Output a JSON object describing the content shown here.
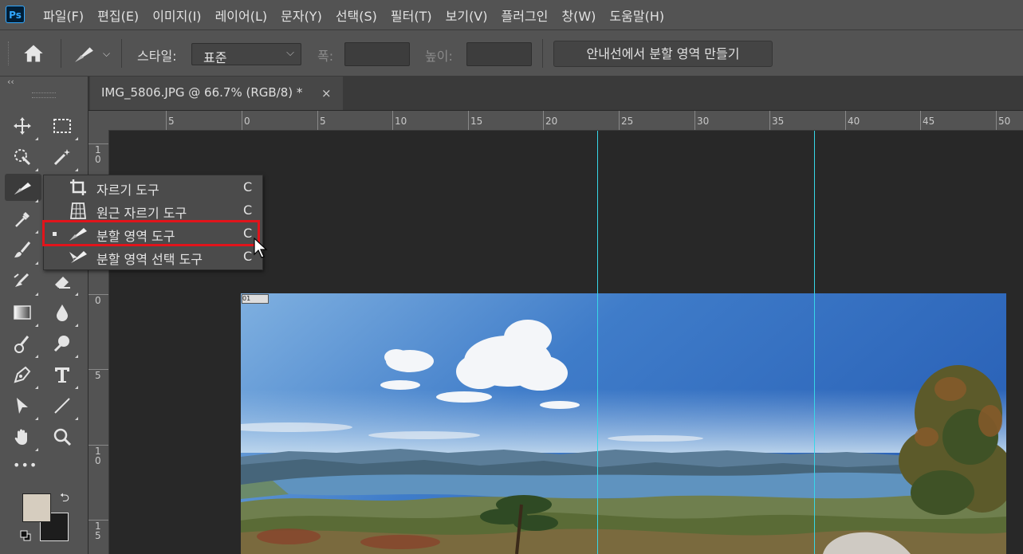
{
  "app": {
    "logo": "Ps",
    "accent": "#31a8ff"
  },
  "menu": [
    "파일(F)",
    "편집(E)",
    "이미지(I)",
    "레이어(L)",
    "문자(Y)",
    "선택(S)",
    "필터(T)",
    "보기(V)",
    "플러그인",
    "창(W)",
    "도움말(H)"
  ],
  "options": {
    "style_label": "스타일:",
    "style_value": "표준",
    "width_label": "폭:",
    "height_label": "높이:",
    "slices_button": "안내선에서 분할 영역 만들기"
  },
  "toolbar": {
    "collapse": "‹‹",
    "icons": [
      "move-icon",
      "marquee-icon",
      "quick-selection-icon",
      "magic-wand-icon",
      "slice-icon",
      "eyedropper-icon",
      "brush-icon",
      "clone-stamp-icon",
      "eraser-icon",
      "gradient-icon",
      "blur-icon",
      "history-brush-icon",
      "dodge-icon",
      "pen-icon",
      "type-icon",
      "path-selection-icon",
      "line-icon",
      "hand-icon",
      "zoom-icon",
      "more-tools-icon"
    ],
    "more": "•••",
    "foreground_color": "#d6cdbf",
    "background_color": "#1d1d1d"
  },
  "document": {
    "tab_title": "IMG_5806.JPG @ 66.7% (RGB/8) *",
    "close": "×",
    "slice_badge": "01"
  },
  "ruler": {
    "top_labels": [
      "5",
      "0",
      "5",
      "10",
      "15",
      "20",
      "25",
      "30",
      "35",
      "40",
      "45",
      "50"
    ],
    "left_labels": [
      "10",
      "0",
      "5",
      "10",
      "15"
    ]
  },
  "flyout": {
    "items": [
      {
        "label": "자르기 도구",
        "shortcut": "C",
        "icon": "crop-icon"
      },
      {
        "label": "원근 자르기 도구",
        "shortcut": "C",
        "icon": "perspective-crop-icon"
      },
      {
        "label": "분할 영역 도구",
        "shortcut": "C",
        "icon": "slice-icon",
        "active": true
      },
      {
        "label": "분할 영역 선택 도구",
        "shortcut": "C",
        "icon": "slice-select-icon"
      }
    ],
    "highlight_color": "#e1141b"
  }
}
